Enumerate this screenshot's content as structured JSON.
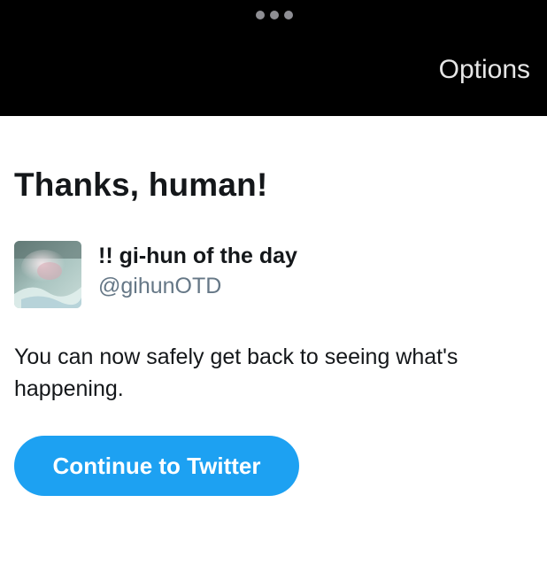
{
  "top_bar": {
    "menu_icon": "more-dots-icon",
    "options_label": "Options"
  },
  "confirmation": {
    "heading": "Thanks, human!",
    "account": {
      "display_name": "!! gi-hun of the day",
      "handle": "@gihunOTD",
      "avatar_icon": "profile-photo"
    },
    "message": "You can now safely get back to seeing what's happening.",
    "continue_label": "Continue to Twitter"
  },
  "colors": {
    "accent": "#1da1f2",
    "top_bar_bg": "#000000",
    "text_primary": "#14171a",
    "text_secondary": "#657786"
  }
}
